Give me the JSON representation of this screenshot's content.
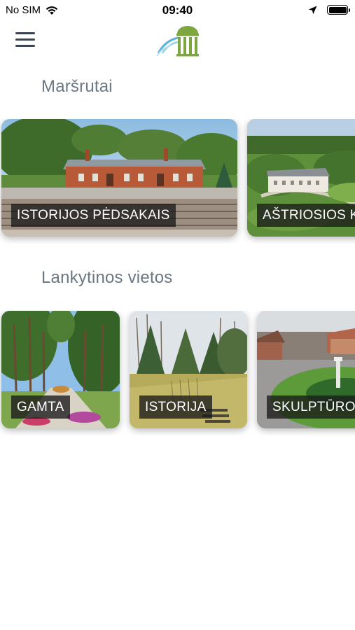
{
  "status_bar": {
    "carrier": "No SIM",
    "time": "09:40",
    "icons": [
      "wifi-icon",
      "location-arrow-icon",
      "battery-icon"
    ]
  },
  "nav": {
    "menu_icon": "hamburger-menu-icon",
    "logo_icon": "rotunda-logo-icon"
  },
  "sections": [
    {
      "title": "Maršrutai",
      "cards": [
        {
          "label": "ISTORIJOS PĖDSAKAIS"
        },
        {
          "label": "AŠTRIOSIOS K"
        }
      ]
    },
    {
      "title": "Lankytinos vietos",
      "cards": [
        {
          "label": "GAMTA"
        },
        {
          "label": "ISTORIJA"
        },
        {
          "label": "SKULPTŪROS"
        }
      ]
    }
  ],
  "colors": {
    "section_title": "#6b7782",
    "label_bg": "#191919",
    "logo_green": "#7da63f",
    "logo_blue": "#5bb3d8"
  }
}
